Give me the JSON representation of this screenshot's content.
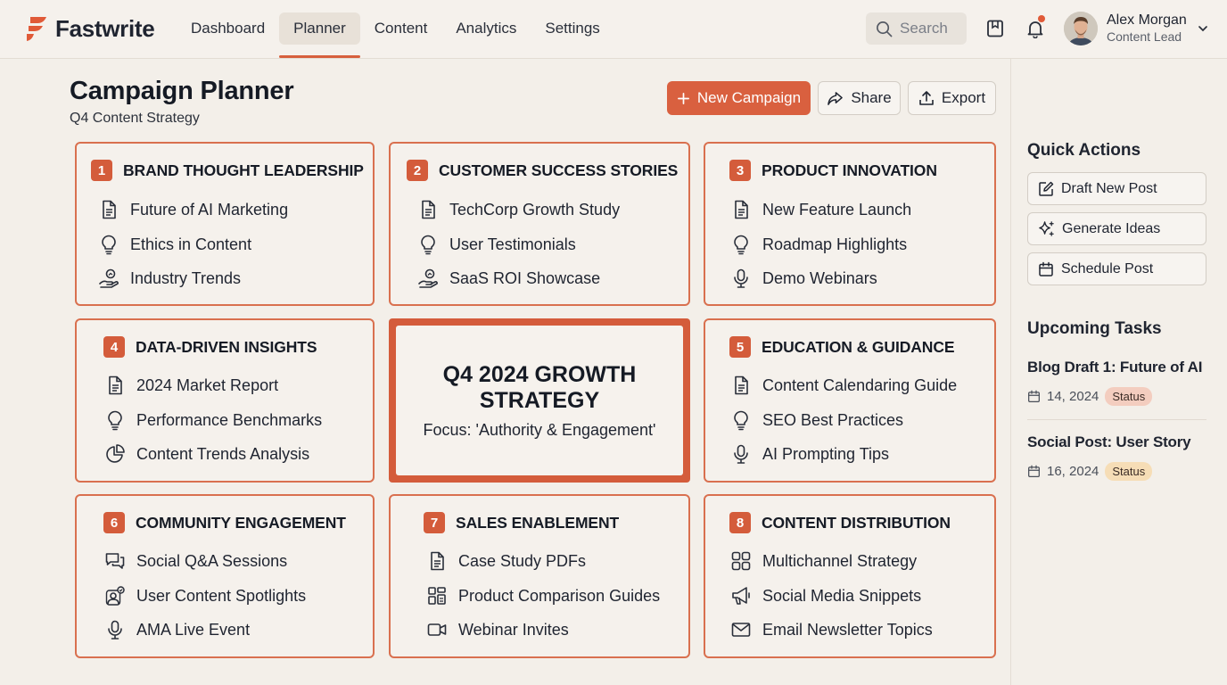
{
  "app": {
    "name": "Fastwrite",
    "nav": [
      "Dashboard",
      "Planner",
      "Content",
      "Analytics",
      "Settings"
    ],
    "active_nav": "Planner",
    "search_placeholder": "Search",
    "user": {
      "name": "Alex Morgan",
      "role": "Content Lead"
    }
  },
  "header": {
    "title": "Campaign Planner",
    "subtitle": "Q4 Content Strategy",
    "new_campaign_label": "New Campaign",
    "share_label": "Share",
    "export_label": "Export"
  },
  "colors": {
    "accent": "#d9603f",
    "card_border": "#d9704f",
    "background": "#f3efe9"
  },
  "center": {
    "title": "Q4 2024 GROWTH STRATEGY",
    "subtitle": "Focus: 'Authority & Engagement'"
  },
  "cards": [
    {
      "num": "1",
      "title": "BRAND THOUGHT LEADERSHIP",
      "items": [
        {
          "label": "Future of AI Marketing",
          "icon": "document-icon"
        },
        {
          "label": "Ethics in Content",
          "icon": "lightbulb-icon"
        },
        {
          "label": "Industry Trends",
          "icon": "trend-hand-icon"
        }
      ]
    },
    {
      "num": "2",
      "title": "CUSTOMER SUCCESS STORIES",
      "items": [
        {
          "label": "TechCorp Growth Study",
          "icon": "document-icon"
        },
        {
          "label": "User Testimonials",
          "icon": "lightbulb-icon"
        },
        {
          "label": "SaaS ROI Showcase",
          "icon": "trend-hand-icon"
        }
      ]
    },
    {
      "num": "3",
      "title": "PRODUCT INNOVATION",
      "items": [
        {
          "label": "New Feature Launch",
          "icon": "document-icon"
        },
        {
          "label": "Roadmap Highlights",
          "icon": "lightbulb-icon"
        },
        {
          "label": "Demo Webinars",
          "icon": "microphone-icon"
        }
      ]
    },
    {
      "num": "4",
      "title": "DATA-DRIVEN INSIGHTS",
      "items": [
        {
          "label": "2024 Market Report",
          "icon": "document-icon"
        },
        {
          "label": "Performance Benchmarks",
          "icon": "lightbulb-icon"
        },
        {
          "label": "Content Trends Analysis",
          "icon": "pie-chart-icon"
        }
      ]
    },
    {
      "num": "5",
      "title": "EDUCATION & GUIDANCE",
      "items": [
        {
          "label": "Content Calendaring Guide",
          "icon": "document-icon"
        },
        {
          "label": "SEO Best Practices",
          "icon": "lightbulb-icon"
        },
        {
          "label": "AI Prompting Tips",
          "icon": "microphone-icon"
        }
      ]
    },
    {
      "num": "6",
      "title": "COMMUNITY ENGAGEMENT",
      "items": [
        {
          "label": "Social Q&A Sessions",
          "icon": "chat-icon"
        },
        {
          "label": "User Content Spotlights",
          "icon": "user-spotlight-icon"
        },
        {
          "label": "AMA Live Event",
          "icon": "microphone-icon"
        }
      ]
    },
    {
      "num": "7",
      "title": "SALES ENABLEMENT",
      "items": [
        {
          "label": "Case Study PDFs",
          "icon": "document-icon"
        },
        {
          "label": "Product Comparison Guides",
          "icon": "compare-grid-icon"
        },
        {
          "label": "Webinar Invites",
          "icon": "video-icon"
        }
      ]
    },
    {
      "num": "8",
      "title": "CONTENT DISTRIBUTION",
      "items": [
        {
          "label": "Multichannel Strategy",
          "icon": "grid-icon"
        },
        {
          "label": "Social Media Snippets",
          "icon": "megaphone-icon"
        },
        {
          "label": "Email Newsletter Topics",
          "icon": "mail-icon"
        }
      ]
    }
  ],
  "quick_actions": {
    "heading": "Quick Actions",
    "items": [
      {
        "label": "Draft New Post",
        "icon": "pencil-icon"
      },
      {
        "label": "Generate Ideas",
        "icon": "sparkle-icon"
      },
      {
        "label": "Schedule Post",
        "icon": "calendar-icon"
      }
    ]
  },
  "upcoming": {
    "heading": "Upcoming Tasks",
    "tasks": [
      {
        "title": "Blog Draft 1: Future of AI",
        "date": "14, 2024",
        "status": "Status",
        "status_color": "#f3cdbf"
      },
      {
        "title": "Social Post: User Story",
        "date": "16, 2024",
        "status": "Status",
        "status_color": "#f6ddb6"
      }
    ]
  }
}
